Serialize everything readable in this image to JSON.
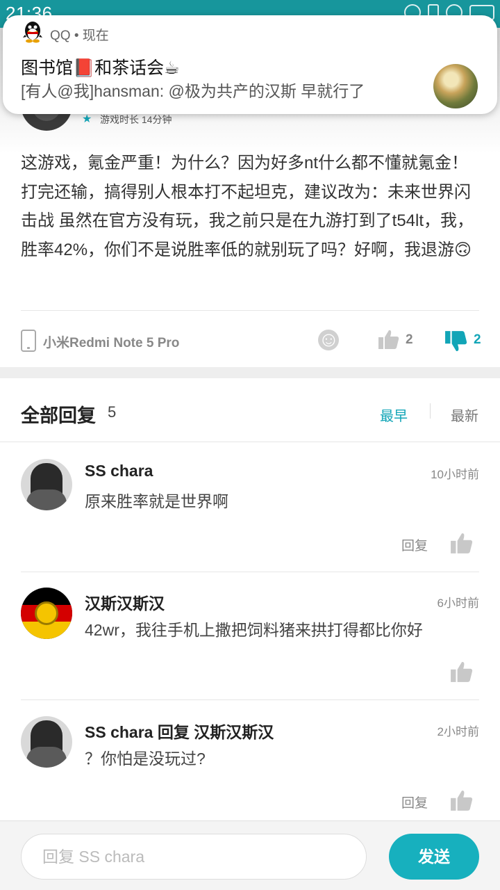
{
  "status_bar": {
    "time": "21:36",
    "network": "4G"
  },
  "notification": {
    "app": "QQ",
    "when": "现在",
    "title": "图书馆📕和茶话会☕",
    "body": "[有人@我]hansman: @极为共产的汉斯 早就行了"
  },
  "post": {
    "playtime": "游戏时长 14分钟",
    "text": "这游戏，氪金严重！为什么？因为好多nt什么都不懂就氪金！打完还输，搞得别人根本打不起坦克，建议改为：未来世界闪击战 虽然在官方没有玩，我之前只是在九游打到了t54lt，我，胜率42%，你们不是说胜率低的就别玩了吗？好啊，我退游🙃",
    "device": "小米Redmi Note 5 Pro",
    "likes": "2",
    "dislikes": "2"
  },
  "replies_header": {
    "title": "全部回复",
    "count": "5",
    "sort_earliest": "最早",
    "sort_latest": "最新"
  },
  "replies": [
    {
      "name": "SS chara",
      "time": "10小时前",
      "text": "原来胜率就是世界啊",
      "reply_label": "回复"
    },
    {
      "name": "汉斯汉斯汉",
      "time": "6小时前",
      "text": "42wr，我往手机上撒把饲料猪来拱打得都比你好",
      "reply_label": ""
    },
    {
      "name": "SS chara  回复  汉斯汉斯汉",
      "time": "2小时前",
      "text": "？你怕是没玩过?",
      "reply_label": "回复"
    }
  ],
  "input": {
    "placeholder": "回复 SS chara",
    "send_label": "发送"
  },
  "colors": {
    "accent": "#12a5b7",
    "status_bar": "#17969c",
    "send_button": "#17b0be"
  }
}
